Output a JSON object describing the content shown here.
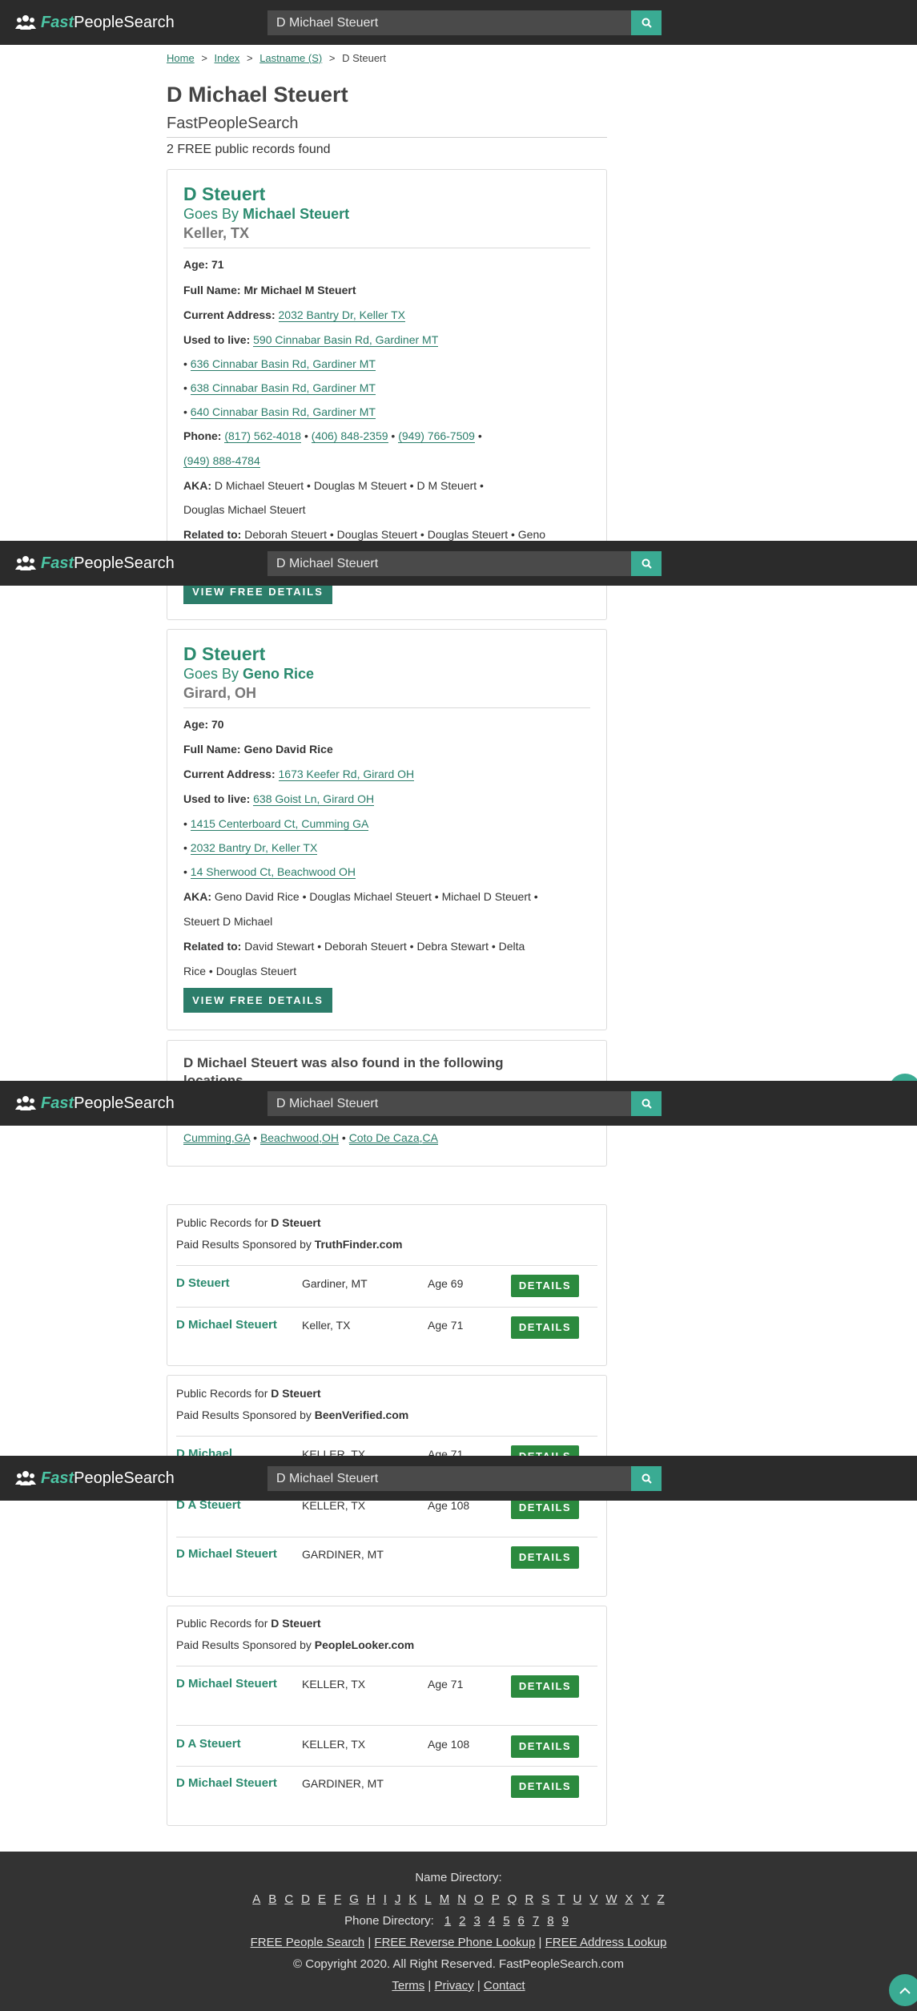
{
  "header": {
    "logo_fast": "Fast",
    "logo_rest": "PeopleSearch",
    "search_value": "D Michael Steuert",
    "search_icon": "search-icon",
    "logo_icon": "people-group-icon"
  },
  "breadcrumb": {
    "home": "Home",
    "index": "Index",
    "lastname": "Lastname (S)",
    "current": "D Steuert",
    "sep": ">"
  },
  "page": {
    "title": "D Michael Steuert",
    "subtitle": "FastPeopleSearch",
    "found": "2 FREE public records found"
  },
  "cards": [
    {
      "name": "D Steuert",
      "goes_prefix": "Goes By",
      "goes_by": "Michael Steuert",
      "location": "Keller, TX",
      "age_label": "Age:",
      "age": "71",
      "fullname_label": "Full Name:",
      "fullname": "Mr Michael M Steuert",
      "current_label": "Current Address:",
      "current": "2032 Bantry Dr, Keller TX",
      "used_label": "Used to live:",
      "used": "590 Cinnabar Basin Rd, Gardiner MT",
      "prev": [
        "636 Cinnabar Basin Rd, Gardiner MT",
        "638 Cinnabar Basin Rd, Gardiner MT",
        "640 Cinnabar Basin Rd, Gardiner MT"
      ],
      "phone_label": "Phone:",
      "phones": [
        "(817) 562-4018",
        "(406) 848-2359",
        "(949) 766-7509",
        "(949) 888-4784"
      ],
      "aka_label": "AKA:",
      "aka_line1": "D Michael Steuert • Douglas M Steuert • D M Steuert •",
      "aka_line2": "Douglas Michael Steuert",
      "related_label": "Related to:",
      "related_line1": "Deborah Steuert • Douglas Steuert • Douglas Steuert • Geno",
      "button": "VIEW FREE DETAILS"
    },
    {
      "name": "D Steuert",
      "goes_prefix": "Goes By",
      "goes_by": "Geno Rice",
      "location": "Girard, OH",
      "age_label": "Age:",
      "age": "70",
      "fullname_label": "Full Name:",
      "fullname": "Geno David Rice",
      "current_label": "Current Address:",
      "current": "1673 Keefer Rd, Girard OH",
      "used_label": "Used to live:",
      "used": "638 Goist Ln, Girard OH",
      "prev": [
        "1415 Centerboard Ct, Cumming GA",
        "2032 Bantry Dr, Keller TX",
        "14 Sherwood Ct, Beachwood OH"
      ],
      "aka_label": "AKA:",
      "aka_line1": "Geno David Rice • Douglas Michael Steuert • Michael D Steuert •",
      "aka_line2": "Steuert D Michael",
      "related_label": "Related to:",
      "related_line1": "David Stewart • Deborah Steuert • Debra Stewart • Delta",
      "related_line2": "Rice • Douglas Steuert",
      "button": "VIEW FREE DETAILS"
    }
  ],
  "also_found": {
    "title_line1": "D Michael Steuert was also found in the following",
    "title_line2": "locations",
    "locations": [
      "Cumming,GA",
      "Beachwood,OH",
      "Coto De Caza,CA"
    ]
  },
  "sponsored": [
    {
      "prefix": "Public Records for",
      "person": "D Steuert",
      "sponsor_prefix": "Paid Results Sponsored by",
      "sponsor": "TruthFinder.com",
      "rows": [
        {
          "name": "D Steuert",
          "location": "Gardiner, MT",
          "age": "Age 69",
          "button": "DETAILS"
        },
        {
          "name": "D Michael Steuert",
          "location": "Keller, TX",
          "age": "Age 71",
          "button": "DETAILS"
        }
      ]
    },
    {
      "prefix": "Public Records for",
      "person": "D Steuert",
      "sponsor_prefix": "Paid Results Sponsored by",
      "sponsor": "BeenVerified.com",
      "rows": [
        {
          "name": "D Michael",
          "location": "KELLER, TX",
          "age": "Age 71",
          "button": "DETAILS"
        },
        {
          "name": "D A Steuert",
          "location": "KELLER, TX",
          "age": "Age 108",
          "button": "DETAILS"
        },
        {
          "name": "D Michael Steuert",
          "location": "GARDINER, MT",
          "age": "",
          "button": "DETAILS"
        }
      ]
    },
    {
      "prefix": "Public Records for",
      "person": "D Steuert",
      "sponsor_prefix": "Paid Results Sponsored by",
      "sponsor": "PeopleLooker.com",
      "rows": [
        {
          "name": "D Michael Steuert",
          "location": "KELLER, TX",
          "age": "Age 71",
          "button": "DETAILS"
        },
        {
          "name": "D A Steuert",
          "location": "KELLER, TX",
          "age": "Age 108",
          "button": "DETAILS"
        },
        {
          "name": "D Michael Steuert",
          "location": "GARDINER, MT",
          "age": "",
          "button": "DETAILS"
        }
      ]
    }
  ],
  "footer": {
    "name_directory": "Name Directory:",
    "letters": [
      "A",
      "B",
      "C",
      "D",
      "E",
      "F",
      "G",
      "H",
      "I",
      "J",
      "K",
      "L",
      "M",
      "N",
      "O",
      "P",
      "Q",
      "R",
      "S",
      "T",
      "U",
      "V",
      "W",
      "X",
      "Y",
      "Z"
    ],
    "phone_directory": "Phone Directory:",
    "digits": [
      "1",
      "2",
      "3",
      "4",
      "5",
      "6",
      "7",
      "8",
      "9"
    ],
    "links_line": [
      "FREE People Search",
      "FREE Reverse Phone Lookup",
      "FREE Address Lookup"
    ],
    "link_sep": "|",
    "copyright": "© Copyright 2020. All Right Reserved. FastPeopleSearch.com",
    "bottom_links": [
      "Terms",
      "Privacy",
      "Contact"
    ]
  },
  "colors": {
    "header_bg": "#2b2b2b",
    "brand_green": "#4cc6a5",
    "link_green": "#2a7d6a",
    "button_green": "#2c7d6a",
    "details_green": "#2b8a3e",
    "footer_bg": "#333333"
  }
}
